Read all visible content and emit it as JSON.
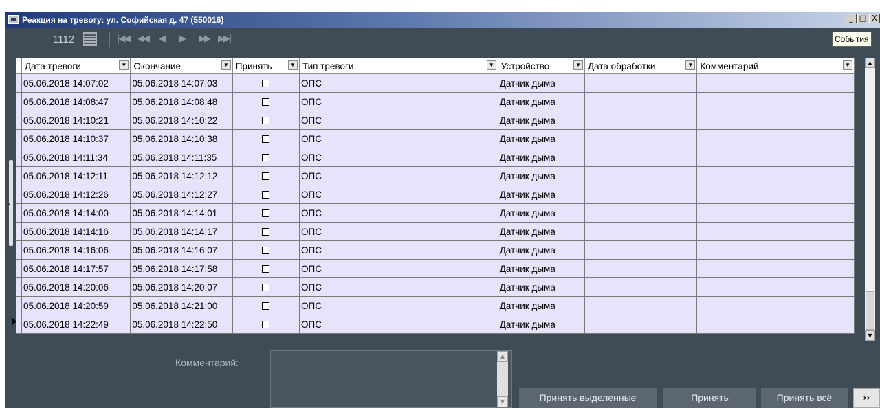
{
  "window": {
    "title": "Реакция на тревогу: ул. Софийская д. 47 (550016)",
    "buttons": [
      "_",
      "□",
      "X"
    ]
  },
  "tooltip": "События",
  "toolbar": {
    "record_count": "1112",
    "nav": [
      "|◀◀",
      "◀◀",
      "◀",
      "▶",
      "▶▶",
      "▶▶|"
    ]
  },
  "table": {
    "columns": [
      "Дата тревоги",
      "Окончание",
      "Принять",
      "Тип тревоги",
      "Устройство",
      "Дата обработки",
      "Комментарий"
    ],
    "rows": [
      {
        "start": "05.06.2018 14:07:02",
        "end": "05.06.2018 14:07:03",
        "accepted": false,
        "type": "ОПС",
        "device": "Датчик дыма",
        "processed": "",
        "comment": ""
      },
      {
        "start": "05.06.2018 14:08:47",
        "end": "05.06.2018 14:08:48",
        "accepted": false,
        "type": "ОПС",
        "device": "Датчик дыма",
        "processed": "",
        "comment": ""
      },
      {
        "start": "05.06.2018 14:10:21",
        "end": "05.06.2018 14:10:22",
        "accepted": false,
        "type": "ОПС",
        "device": "Датчик дыма",
        "processed": "",
        "comment": ""
      },
      {
        "start": "05.06.2018 14:10:37",
        "end": "05.06.2018 14:10:38",
        "accepted": false,
        "type": "ОПС",
        "device": "Датчик дыма",
        "processed": "",
        "comment": ""
      },
      {
        "start": "05.06.2018 14:11:34",
        "end": "05.06.2018 14:11:35",
        "accepted": false,
        "type": "ОПС",
        "device": "Датчик дыма",
        "processed": "",
        "comment": ""
      },
      {
        "start": "05.06.2018 14:12:11",
        "end": "05.06.2018 14:12:12",
        "accepted": false,
        "type": "ОПС",
        "device": "Датчик дыма",
        "processed": "",
        "comment": ""
      },
      {
        "start": "05.06.2018 14:12:26",
        "end": "05.06.2018 14:12:27",
        "accepted": false,
        "type": "ОПС",
        "device": "Датчик дыма",
        "processed": "",
        "comment": ""
      },
      {
        "start": "05.06.2018 14:14:00",
        "end": "05.06.2018 14:14:01",
        "accepted": false,
        "type": "ОПС",
        "device": "Датчик дыма",
        "processed": "",
        "comment": ""
      },
      {
        "start": "05.06.2018 14:14:16",
        "end": "05.06.2018 14:14:17",
        "accepted": false,
        "type": "ОПС",
        "device": "Датчик дыма",
        "processed": "",
        "comment": ""
      },
      {
        "start": "05.06.2018 14:16:06",
        "end": "05.06.2018 14:16:07",
        "accepted": false,
        "type": "ОПС",
        "device": "Датчик дыма",
        "processed": "",
        "comment": ""
      },
      {
        "start": "05.06.2018 14:17:57",
        "end": "05.06.2018 14:17:58",
        "accepted": false,
        "type": "ОПС",
        "device": "Датчик дыма",
        "processed": "",
        "comment": ""
      },
      {
        "start": "05.06.2018 14:20:06",
        "end": "05.06.2018 14:20:07",
        "accepted": false,
        "type": "ОПС",
        "device": "Датчик дыма",
        "processed": "",
        "comment": ""
      },
      {
        "start": "05.06.2018 14:20:59",
        "end": "05.06.2018 14:21:00",
        "accepted": false,
        "type": "ОПС",
        "device": "Датчик дыма",
        "processed": "",
        "comment": ""
      },
      {
        "start": "05.06.2018 14:22:49",
        "end": "05.06.2018 14:22:50",
        "accepted": false,
        "type": "ОПС",
        "device": "Датчик дыма",
        "processed": "",
        "comment": "",
        "selected": true
      }
    ]
  },
  "comment": {
    "label": "Комментарий:",
    "value": ""
  },
  "actions": {
    "accept_selected": "Принять выделенные",
    "accept": "Принять",
    "accept_all": "Принять всё",
    "more": "››"
  },
  "colors": {
    "background": "#3f4b55",
    "row": "#e6e4fb",
    "button": "#5b6670"
  }
}
